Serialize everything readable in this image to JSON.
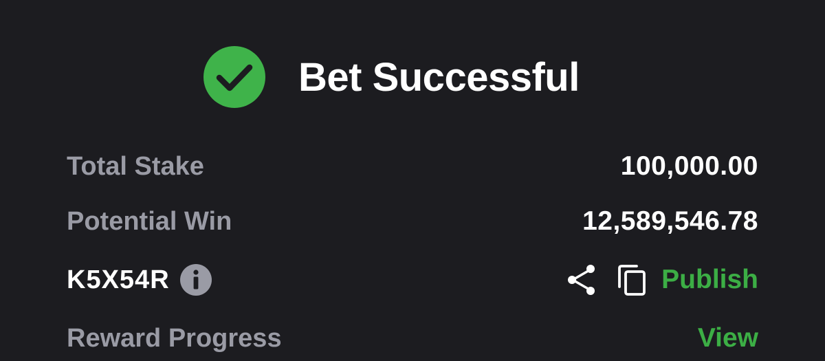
{
  "header": {
    "title": "Bet Successful",
    "icon": "check-circle-icon"
  },
  "summary": {
    "stake_label": "Total Stake",
    "stake_value": "100,000.00",
    "win_label": "Potential Win",
    "win_value": "12,589,546.78"
  },
  "booking": {
    "code": "K5X54R",
    "info_icon": "info-icon",
    "share_icon": "share-icon",
    "copy_icon": "copy-icon",
    "publish_label": "Publish"
  },
  "reward": {
    "label": "Reward Progress",
    "view_label": "View"
  },
  "colors": {
    "background": "#1c1c20",
    "accent_green": "#3cae45",
    "check_circle": "#3fb34a",
    "label_gray": "#9a9ba5",
    "text_white": "#ffffff"
  }
}
